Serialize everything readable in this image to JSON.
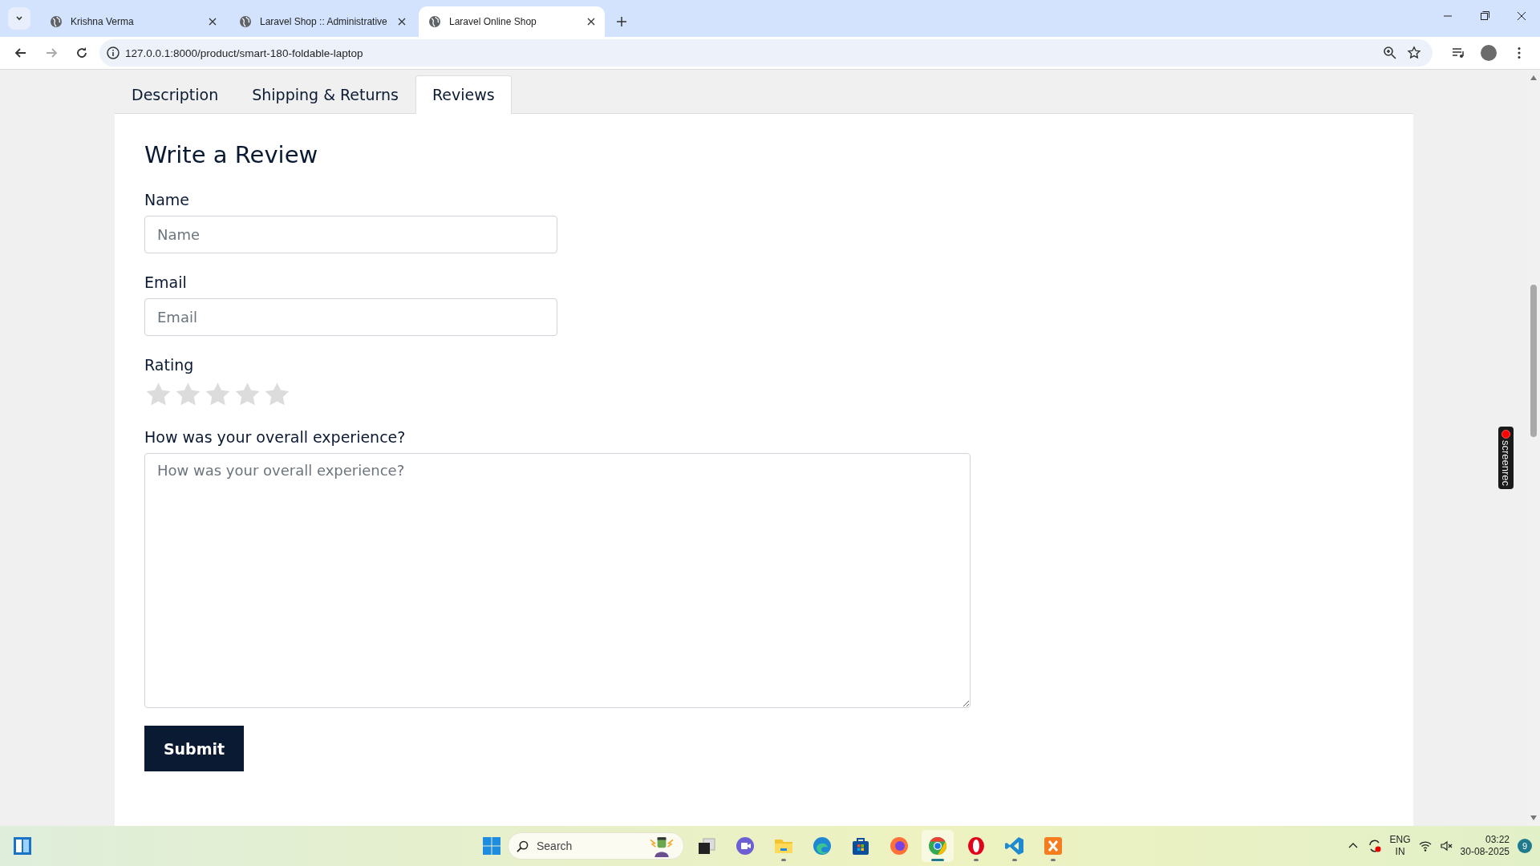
{
  "browser": {
    "tabs": [
      {
        "title": "Krishna Verma",
        "selected": false
      },
      {
        "title": "Laravel Shop :: Administrative",
        "selected": false
      },
      {
        "title": "Laravel Online Shop",
        "selected": true
      }
    ],
    "url": "127.0.0.1:8000/product/smart-180-foldable-laptop",
    "forward_disabled": true
  },
  "product_tabs": [
    {
      "label": "Description",
      "selected": false
    },
    {
      "label": "Shipping & Returns",
      "selected": false
    },
    {
      "label": "Reviews",
      "selected": true
    }
  ],
  "review_form": {
    "title": "Write a Review",
    "fields": [
      {
        "kind": "input",
        "label": "Name",
        "placeholder": "Name"
      },
      {
        "kind": "input",
        "label": "Email",
        "placeholder": "Email"
      },
      {
        "kind": "rating",
        "label": "Rating",
        "stars": 0
      },
      {
        "kind": "textarea",
        "label": "How was your overall experience?",
        "placeholder": "How was your overall experience?"
      }
    ],
    "submit": "Submit"
  },
  "recorder_badge": "screenrec",
  "taskbar": {
    "search_placeholder": "Search",
    "apps": [
      {
        "kind": "taskview",
        "running": false,
        "selected": false
      },
      {
        "kind": "meet",
        "running": false,
        "selected": false
      },
      {
        "kind": "files",
        "running": true,
        "selected": false
      },
      {
        "kind": "edge",
        "running": false,
        "selected": false
      },
      {
        "kind": "store",
        "running": false,
        "selected": false
      },
      {
        "kind": "firefox",
        "running": false,
        "selected": false
      },
      {
        "kind": "chrome",
        "running": true,
        "selected": true
      },
      {
        "kind": "opera",
        "running": true,
        "selected": false
      },
      {
        "kind": "vscode",
        "running": true,
        "selected": false
      },
      {
        "kind": "xampp",
        "running": true,
        "selected": false
      }
    ],
    "language": "ENG",
    "region": "IN",
    "time": "03:22",
    "date": "30-08-2025",
    "notifications": "9"
  }
}
